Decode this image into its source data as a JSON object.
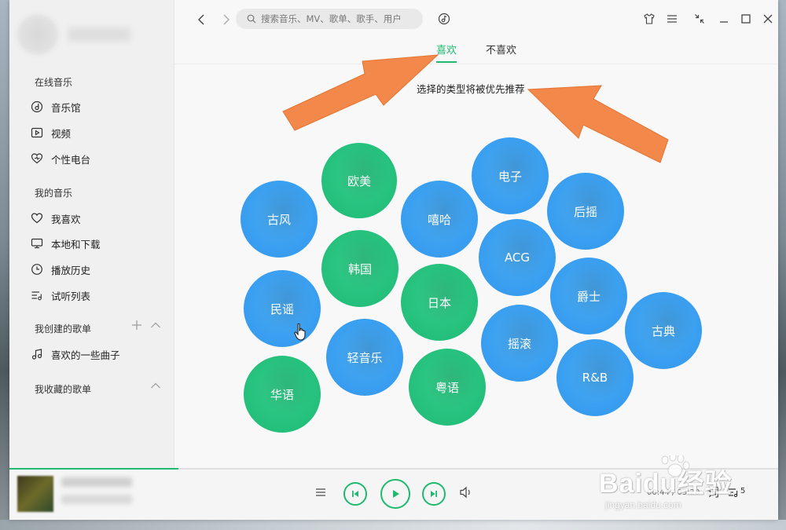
{
  "sidebar": {
    "sections": [
      {
        "title": "在线音乐",
        "items": [
          {
            "label": "音乐馆",
            "icon": "music-hall-icon"
          },
          {
            "label": "视频",
            "icon": "video-icon"
          },
          {
            "label": "个性电台",
            "icon": "radio-heart-icon"
          }
        ]
      },
      {
        "title": "我的音乐",
        "items": [
          {
            "label": "我喜欢",
            "icon": "heart-icon"
          },
          {
            "label": "本地和下载",
            "icon": "monitor-icon"
          },
          {
            "label": "播放历史",
            "icon": "clock-icon"
          },
          {
            "label": "试听列表",
            "icon": "list-icon"
          }
        ]
      },
      {
        "title": "我创建的歌单",
        "items": [
          {
            "label": "喜欢的一些曲子",
            "icon": "note-icon"
          }
        ]
      },
      {
        "title": "我收藏的歌单",
        "items": []
      }
    ]
  },
  "search": {
    "placeholder": "搜索音乐、MV、歌单、歌手、用户"
  },
  "tabs": [
    {
      "label": "喜欢",
      "active": true
    },
    {
      "label": "不喜欢",
      "active": false
    }
  ],
  "hint": "选择的类型将被优先推荐",
  "genres": [
    {
      "label": "欧美",
      "color": "green"
    },
    {
      "label": "电子",
      "color": "blue"
    },
    {
      "label": "古风",
      "color": "blue"
    },
    {
      "label": "嘻哈",
      "color": "blue"
    },
    {
      "label": "后摇",
      "color": "blue"
    },
    {
      "label": "韩国",
      "color": "green"
    },
    {
      "label": "ACG",
      "color": "blue"
    },
    {
      "label": "民谣",
      "color": "blue"
    },
    {
      "label": "日本",
      "color": "green"
    },
    {
      "label": "爵士",
      "color": "blue"
    },
    {
      "label": "古典",
      "color": "blue"
    },
    {
      "label": "轻音乐",
      "color": "blue"
    },
    {
      "label": "摇滚",
      "color": "blue"
    },
    {
      "label": "华语",
      "color": "green"
    },
    {
      "label": "粤语",
      "color": "green"
    },
    {
      "label": "R&B",
      "color": "blue"
    }
  ],
  "player": {
    "time": "00:44 / 03:20",
    "lyric_label": "词",
    "playlist_count": "5",
    "progress": 0.22
  },
  "watermark": {
    "brand": "Baidu经验",
    "url": "jingyan.baidu.com"
  },
  "colors": {
    "accent": "#1fba6f",
    "bubble_green": "#25c17d",
    "bubble_blue": "#3a9ff0",
    "arrow": "#f3884b"
  }
}
